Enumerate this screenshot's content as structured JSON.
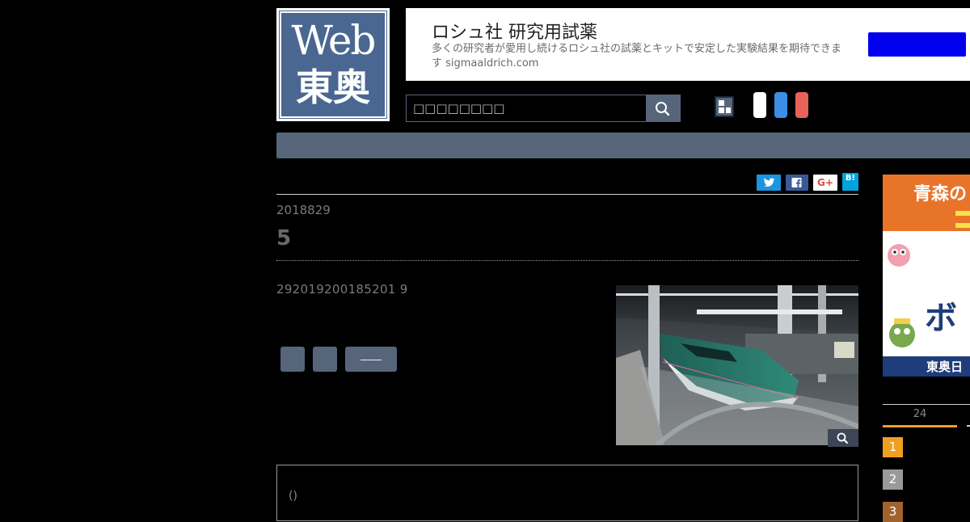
{
  "logo": {
    "line1": "Web",
    "line2": "東奥"
  },
  "ad": {
    "title": "ロシュ社 研究用試薬",
    "description": "多くの研究者が愛用し続けるロシュ社の試薬とキットで安定した実験結果を期待できます sigmaaldrich.com",
    "cta_color": "#0000ee"
  },
  "search": {
    "placeholder": "□□□□□□□□"
  },
  "share": {
    "twitter_color": "#1b95e0",
    "facebook_color": "#3b5998",
    "gplus_label": "G+",
    "hatena_label": "B!"
  },
  "article": {
    "date": "2018829",
    "headline": "5",
    "body": "292019200185201 9",
    "button3_label": "——",
    "box_note": "()"
  },
  "sidebar": {
    "ad_text": [
      "青森の",
      "ボ",
      "東奥日"
    ],
    "ranking_tab": "24",
    "ranks": [
      "1",
      "2",
      "3"
    ]
  },
  "colors": {
    "accent": "#56657a",
    "logo_blue": "#4a6791",
    "rank_gold": "#f0a020"
  }
}
